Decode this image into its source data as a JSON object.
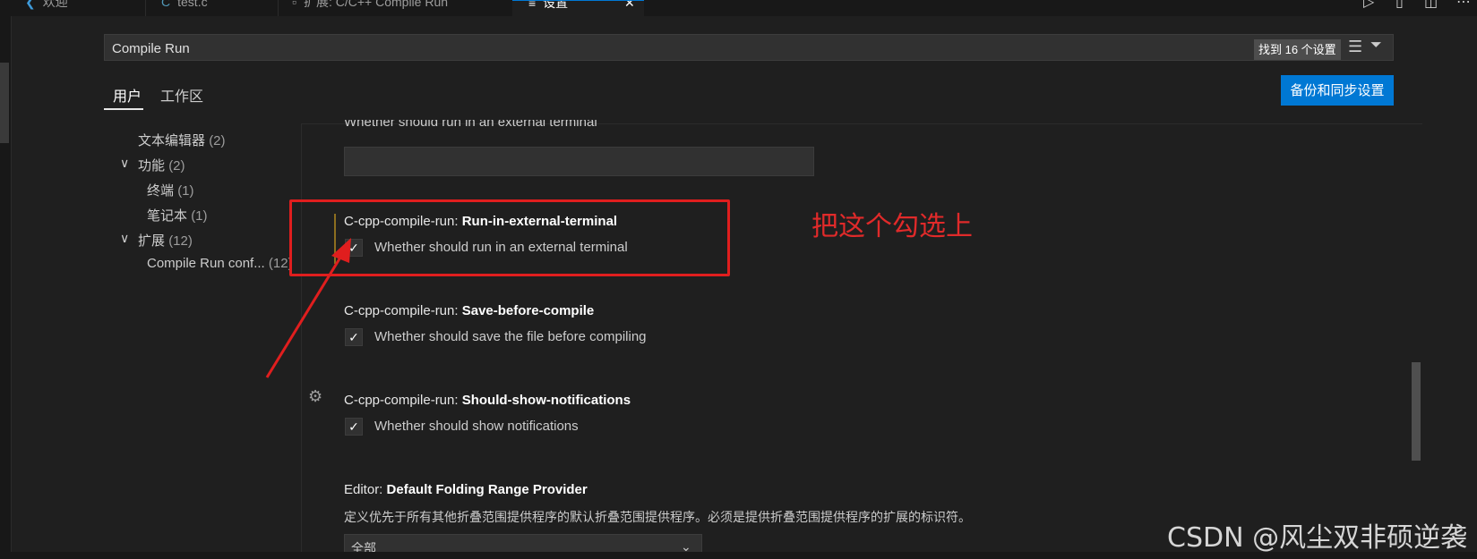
{
  "tabs": [
    {
      "label": "欢迎",
      "icon": "vscode-logo-icon",
      "active": false
    },
    {
      "label": "test.c",
      "icon": "c-file-icon",
      "active": false
    },
    {
      "label": "扩展: C/C++ Compile Run",
      "icon": "extension-icon",
      "active": false
    },
    {
      "label": "设置",
      "icon": "settings-icon",
      "active": true
    }
  ],
  "search": {
    "value": "Compile Run",
    "count_badge": "找到 16 个设置"
  },
  "scopes": {
    "user": "用户",
    "workspace": "工作区"
  },
  "sync_button": "备份和同步设置",
  "toc": [
    {
      "label": "文本编辑器",
      "count": "(2)"
    },
    {
      "label": "功能",
      "count": "(2)"
    },
    {
      "label": "终端",
      "count": "(1)"
    },
    {
      "label": "笔记本",
      "count": "(1)"
    },
    {
      "label": "扩展",
      "count": "(12)"
    },
    {
      "label": "Compile Run conf...",
      "count": "(12)"
    }
  ],
  "settings": {
    "partial_desc": "Whether should run in an external terminal",
    "run_in_external": {
      "prefix": "C-cpp-compile-run: ",
      "name": "Run-in-external-terminal",
      "desc": "Whether should run in an external terminal",
      "checked": true
    },
    "save_before": {
      "prefix": "C-cpp-compile-run: ",
      "name": "Save-before-compile",
      "desc": "Whether should save the file before compiling",
      "checked": true
    },
    "show_notifications": {
      "prefix": "C-cpp-compile-run: ",
      "name": "Should-show-notifications",
      "desc": "Whether should show notifications",
      "checked": true
    },
    "folding": {
      "prefix": "Editor: ",
      "name": "Default Folding Range Provider",
      "desc": "定义优先于所有其他折叠范围提供程序的默认折叠范围提供程序。必须是提供折叠范围提供程序的扩展的标识符。",
      "value": "全部"
    }
  },
  "annotation": {
    "note": "把这个勾选上",
    "color": "#e01e1e"
  },
  "watermark": "CSDN @风尘双非硕逆袭",
  "colors": {
    "accent": "#0078d4",
    "background": "#1f1f1f"
  }
}
